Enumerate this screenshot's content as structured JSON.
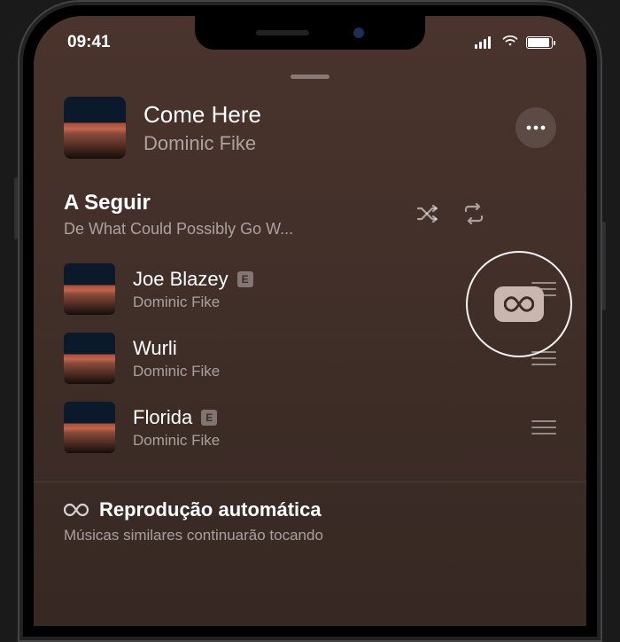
{
  "status": {
    "time": "09:41"
  },
  "now_playing": {
    "title": "Come Here",
    "artist": "Dominic Fike"
  },
  "up_next": {
    "title": "A Seguir",
    "subtitle": "De What Could Possibly Go W..."
  },
  "queue": [
    {
      "title": "Joe Blazey",
      "artist": "Dominic Fike",
      "explicit": true
    },
    {
      "title": "Wurli",
      "artist": "Dominic Fike",
      "explicit": false
    },
    {
      "title": "Florida",
      "artist": "Dominic Fike",
      "explicit": true
    }
  ],
  "autoplay": {
    "title": "Reprodução automática",
    "subtitle": "Músicas similares continuarão tocando"
  },
  "badges": {
    "explicit": "E"
  }
}
